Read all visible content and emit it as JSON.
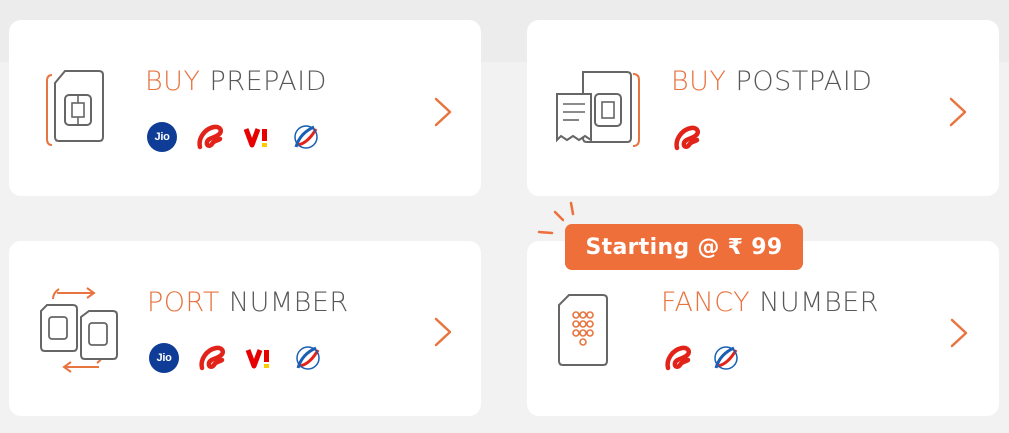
{
  "colors": {
    "accent": "#e8743f",
    "title_text": "#585858",
    "badge_bg": "#ee6f3a",
    "jio_blue": "#0f3c96",
    "airtel_red": "#e2231a",
    "vi_red": "#e60000",
    "vi_yellow": "#ffcc00"
  },
  "cards": [
    {
      "title_accent": "BUY",
      "title_rest": "PREPAID",
      "illustration": "sim-card-icon",
      "operators": [
        "Jio",
        "Airtel",
        "Vi",
        "BSNL"
      ]
    },
    {
      "title_accent": "BUY",
      "title_rest": "POSTPAID",
      "illustration": "sim-with-bill-icon",
      "operators": [
        "Airtel"
      ]
    },
    {
      "title_accent": "PORT",
      "title_rest": "NUMBER",
      "illustration": "port-sim-icon",
      "operators": [
        "Jio",
        "Airtel",
        "Vi",
        "BSNL"
      ]
    },
    {
      "title_accent": "FANCY",
      "title_rest": "NUMBER",
      "illustration": "sim-keypad-icon",
      "operators": [
        "Airtel",
        "BSNL"
      ]
    }
  ],
  "promo_badge": {
    "text": "Starting @ ₹ 99"
  },
  "logo_text": {
    "jio": "Jio"
  }
}
